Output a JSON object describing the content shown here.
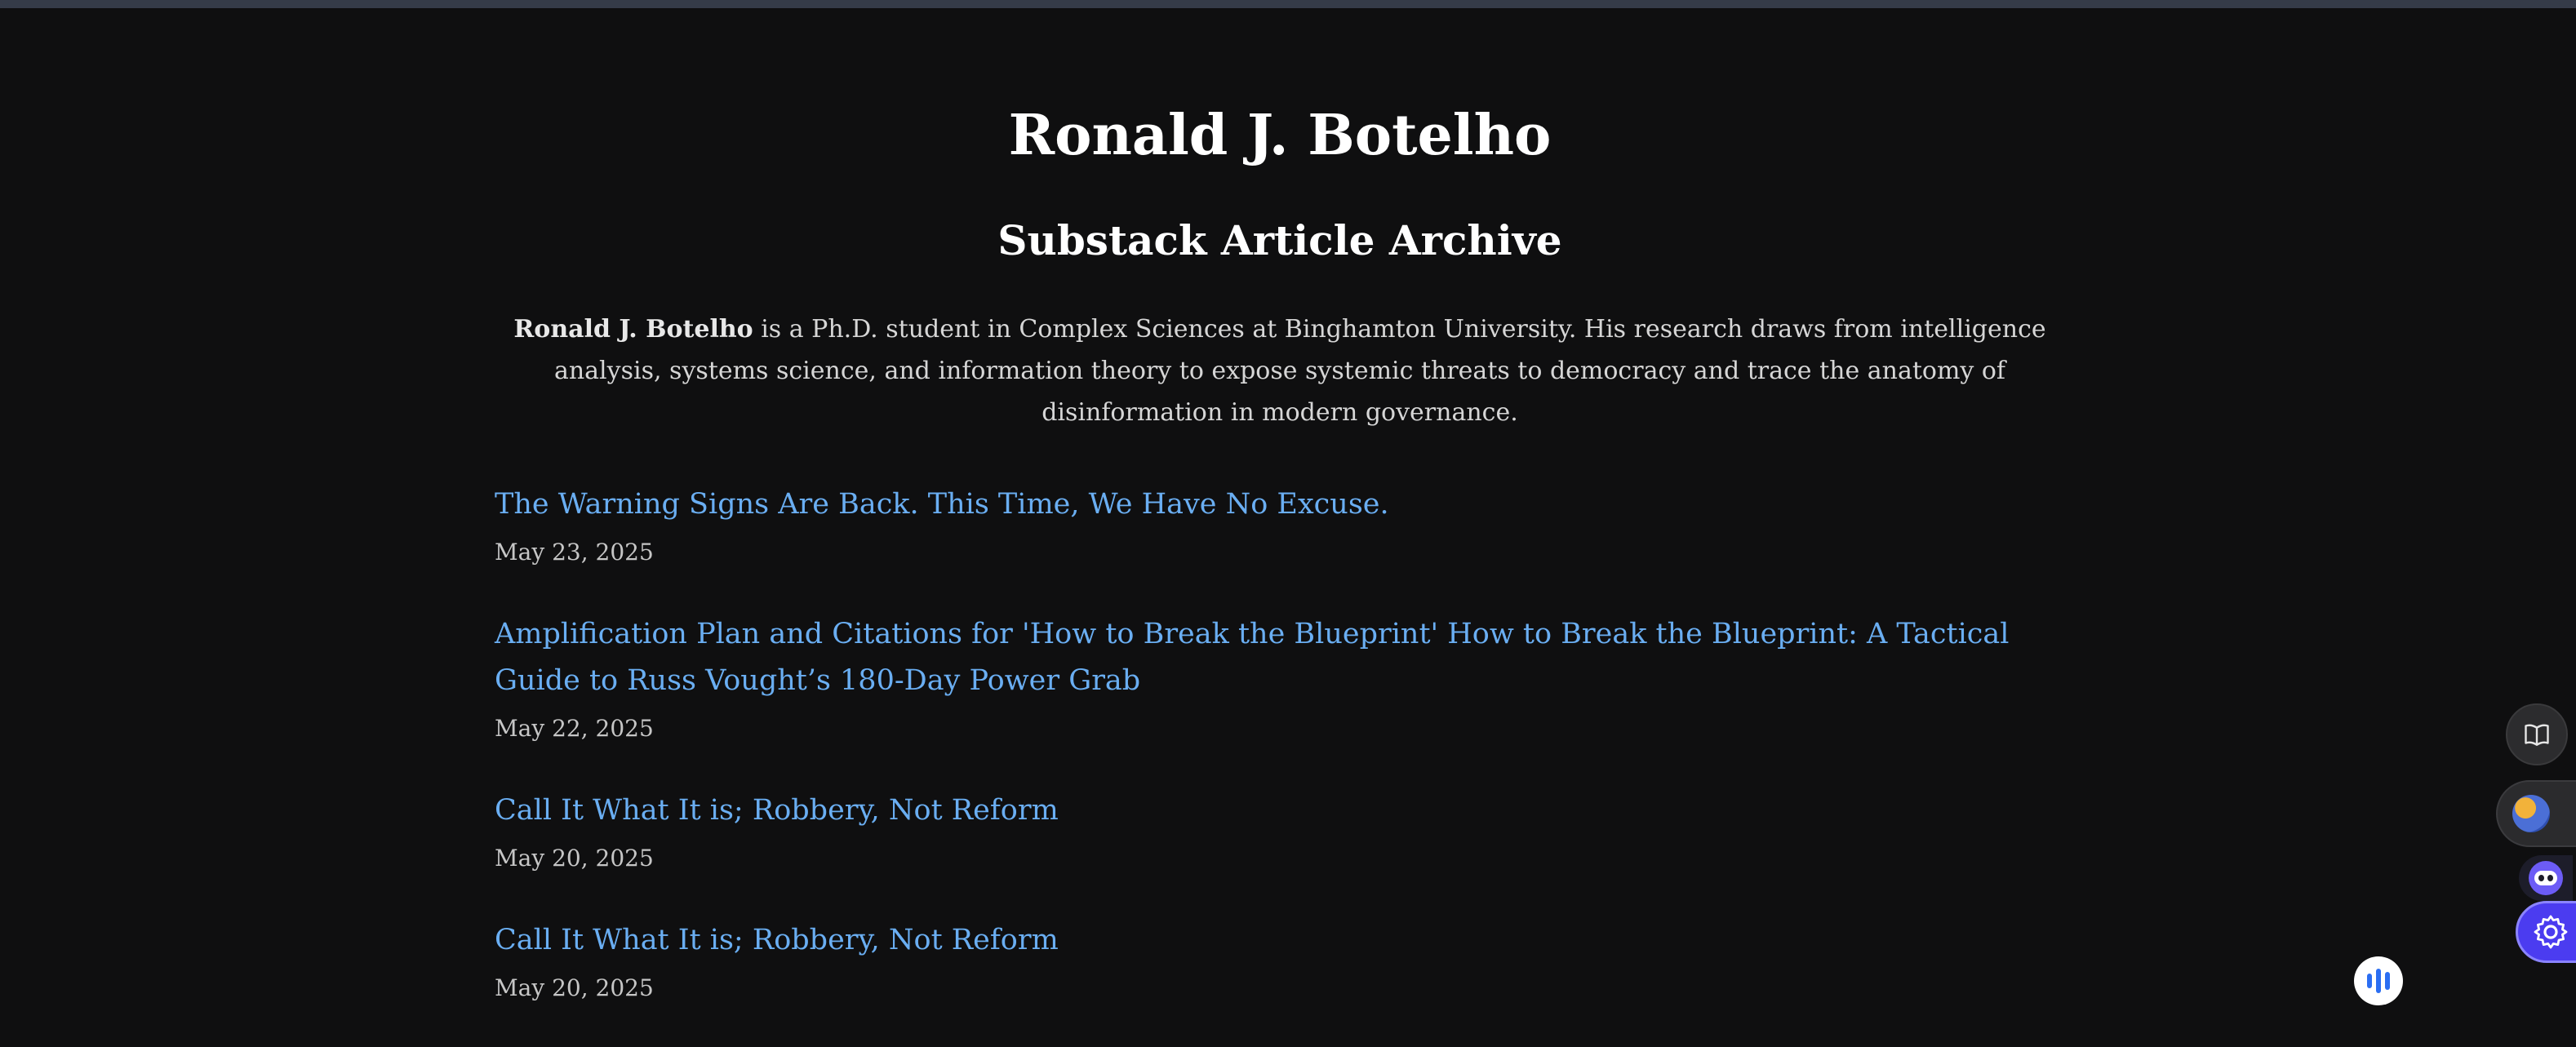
{
  "header": {
    "site_title": "Ronald J. Botelho",
    "archive_title": "Substack Article Archive"
  },
  "bio": {
    "name": "Ronald J. Botelho",
    "text": " is a Ph.D. student in Complex Sciences at Binghamton University. His research draws from intelligence analysis, systems science, and information theory to expose systemic threats to democracy and trace the anatomy of disinformation in modern governance."
  },
  "articles": [
    {
      "title": "The Warning Signs Are Back. This Time, We Have No Excuse.",
      "date": "May 23, 2025"
    },
    {
      "title": "Amplification Plan and Citations for 'How to Break the Blueprint' How to Break the Blueprint: A Tactical Guide to Russ Vought’s 180-Day Power Grab",
      "date": "May 22, 2025"
    },
    {
      "title": "Call It What It is; Robbery, Not Reform",
      "date": "May 20, 2025"
    },
    {
      "title": "Call It What It is; Robbery, Not Reform",
      "date": "May 20, 2025"
    }
  ],
  "floating_controls": {
    "reader_icon": "open-book-icon",
    "extension_icon": "globe-extension-icon",
    "assistant_icon": "robot-face-icon",
    "settings_icon": "gear-icon",
    "voice_icon": "audio-bars-icon"
  },
  "colors": {
    "background": "#0f0f10",
    "link": "#6aaef2",
    "heading": "#ffffff",
    "body_text": "#d6d6d6",
    "date_text": "#c6c6c6"
  }
}
